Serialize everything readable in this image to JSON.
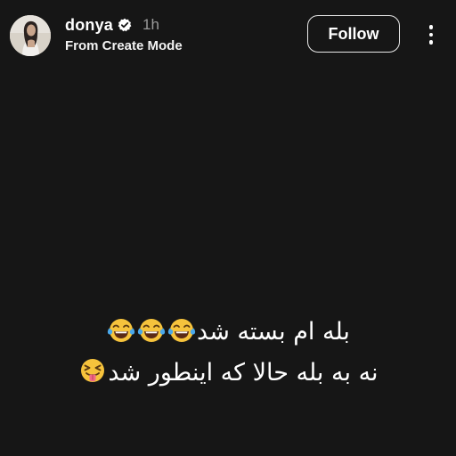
{
  "header": {
    "username": "donya",
    "time": "1h",
    "subtitle": "From Create Mode",
    "follow_label": "Follow",
    "verified_icon": "verified-badge-icon",
    "more_icon": "more-vertical-icon"
  },
  "post": {
    "line1_text": "بله ام بسته شد",
    "line1_emoji": [
      "face-with-tears-of-joy",
      "face-with-tears-of-joy",
      "face-with-tears-of-joy"
    ],
    "line2_text": "نه به بله حالا که اینطور شد",
    "line2_emoji": [
      "squinting-face-with-tongue"
    ]
  },
  "colors": {
    "background": "#161616",
    "text": "#ffffff",
    "muted": "#9a9a9a",
    "verified": "#ffffff"
  }
}
